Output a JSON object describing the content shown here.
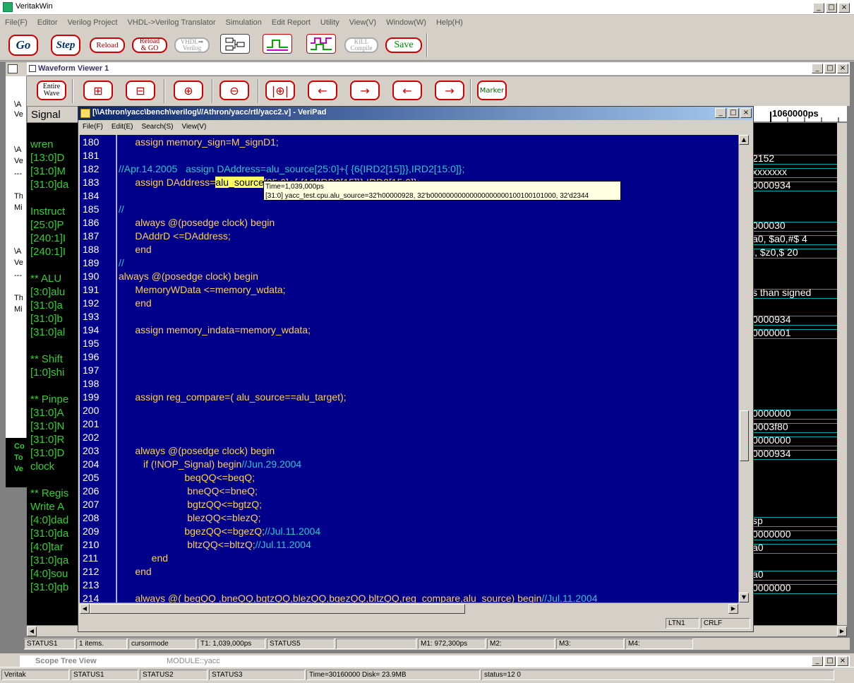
{
  "app": {
    "title": "VeritakWin",
    "menu": [
      "File(F)",
      "Editor",
      "Verilog Project",
      "VHDL->Verilog Translator",
      "Simulation",
      "Edit Report",
      "Utility",
      "View(V)",
      "Window(W)",
      "Help(H)"
    ]
  },
  "toolbar": {
    "go": "Go",
    "step": "Step",
    "reload": "Reload",
    "reload_go_1": "Reload",
    "reload_go_2": "& GO",
    "vhdl_1": "VHDL➡",
    "vhdl_2": "Verilog",
    "kill_1": "KILL",
    "kill_2": "Compile",
    "save": "Save"
  },
  "waveform_viewer": {
    "title": "Waveform Viewer 1",
    "entire_wave_1": "Entire",
    "entire_wave_2": "Wave",
    "marker": "Marker",
    "signal_header": "Signal",
    "time_header": "1060000ps",
    "signals": [
      "wren",
      "[13:0]D",
      "[31:0]M",
      "[31:0]da",
      "",
      "Instruct",
      "[25:0]P",
      "[240:1]I",
      "[240:1]I",
      "",
      "** ALU",
      "[3:0]alu",
      "[31:0]a",
      "[31:0]b",
      "[31:0]al",
      "",
      "** Shift",
      "[1:0]shi",
      "",
      "** Pinpe",
      "[31:0]A",
      "[31:0]N",
      "[31:0]R",
      "[31:0]D",
      "clock",
      "",
      "** Regis",
      " Write A",
      "[4:0]dad",
      "[31:0]da",
      "[4:0]tar",
      "[31:0]qa",
      "[4:0]sou",
      "[31:0]qb"
    ],
    "wave_values": [
      {
        "row": 1,
        "text": "2152"
      },
      {
        "row": 2,
        "text": "xxxxxxx"
      },
      {
        "row": 3,
        "text": "0000934"
      },
      {
        "row": 6,
        "text": "000030"
      },
      {
        "row": 7,
        "text": "a0, $a0,#$  4"
      },
      {
        "row": 8,
        "text": "l, $z0,$   20"
      },
      {
        "row": 11,
        "text": "s than signed"
      },
      {
        "row": 13,
        "text": "0000934"
      },
      {
        "row": 14,
        "text": "0000001"
      },
      {
        "row": 20,
        "text": "0000000"
      },
      {
        "row": 21,
        "text": "0003f80"
      },
      {
        "row": 22,
        "text": "0000000"
      },
      {
        "row": 23,
        "text": "0000934"
      },
      {
        "row": 28,
        "text": "sp"
      },
      {
        "row": 29,
        "text": "0000000"
      },
      {
        "row": 30,
        "text": "a0"
      },
      {
        "row": 32,
        "text": "a0"
      },
      {
        "row": 33,
        "text": "0000000"
      }
    ],
    "status": [
      {
        "text": "STATUS1"
      },
      {
        "text": "1 items."
      },
      {
        "text": "cursormode"
      },
      {
        "text": "T1: 1,039,000ps"
      },
      {
        "text": "STATUS5"
      },
      {
        "text": ""
      },
      {
        "text": "M1: 972,300ps"
      },
      {
        "text": "M2:"
      },
      {
        "text": "M3:"
      },
      {
        "text": "M4:"
      }
    ]
  },
  "left_strip": [
    "\\A",
    "Ve",
    "\\A",
    "Ve",
    "---",
    "Th",
    "Mi",
    "\\A",
    "Ve",
    "---",
    "Th",
    "Mi",
    "Co",
    "To",
    "Ve"
  ],
  "veripad": {
    "title": "[\\\\Athron\\yacc\\bench\\verilog\\//Athron/yacc/rtl/yacc2.v] - VeriPad",
    "menu": [
      "File(F)",
      "Edit(E)",
      "Search(S)",
      "View(V)"
    ],
    "status_ln": "LTN1",
    "status_crlf": "CRLF",
    "lines": [
      {
        "n": "180",
        "segs": [
          {
            "t": "      assign memory_sign=M_signD1;",
            "k": "y"
          }
        ]
      },
      {
        "n": "181",
        "segs": []
      },
      {
        "n": "182",
        "segs": [
          {
            "t": "//Apr.14.2005   assign DAddress=alu_source[25:0]+{ {6{IRD2[15]}},IRD2[15:0]};",
            "k": "c"
          }
        ]
      },
      {
        "n": "183",
        "segs": [
          {
            "t": "      assign DAddress=",
            "k": "y"
          },
          {
            "t": "alu_source",
            "k": "hl"
          },
          {
            "t": "[25:0]+{ {16{IRD2[15]}},IRD2[15:0]};",
            "k": "y"
          }
        ]
      },
      {
        "n": "184",
        "segs": []
      },
      {
        "n": "185",
        "segs": [
          {
            "t": "//",
            "k": "c"
          }
        ]
      },
      {
        "n": "186",
        "segs": [
          {
            "t": "      always @(posedge clock) begin",
            "k": "y"
          }
        ]
      },
      {
        "n": "187",
        "segs": [
          {
            "t": "      DAddrD <=DAddress;",
            "k": "y"
          }
        ]
      },
      {
        "n": "188",
        "segs": [
          {
            "t": "      end",
            "k": "y"
          }
        ]
      },
      {
        "n": "189",
        "segs": [
          {
            "t": "//",
            "k": "c"
          }
        ]
      },
      {
        "n": "190",
        "segs": [
          {
            "t": "always @(posedge clock) begin",
            "k": "y"
          }
        ]
      },
      {
        "n": "191",
        "segs": [
          {
            "t": "      MemoryWData <=memory_wdata;",
            "k": "y"
          }
        ]
      },
      {
        "n": "192",
        "segs": [
          {
            "t": "      end",
            "k": "y"
          }
        ]
      },
      {
        "n": "193",
        "segs": []
      },
      {
        "n": "194",
        "segs": [
          {
            "t": "      assign memory_indata=memory_wdata;",
            "k": "y"
          }
        ]
      },
      {
        "n": "195",
        "segs": []
      },
      {
        "n": "196",
        "segs": []
      },
      {
        "n": "197",
        "segs": []
      },
      {
        "n": "198",
        "segs": []
      },
      {
        "n": "199",
        "segs": [
          {
            "t": "      assign reg_compare=( alu_source==alu_target);",
            "k": "y"
          }
        ]
      },
      {
        "n": "200",
        "segs": []
      },
      {
        "n": "201",
        "segs": []
      },
      {
        "n": "202",
        "segs": []
      },
      {
        "n": "203",
        "segs": [
          {
            "t": "      always @(posedge clock) begin",
            "k": "y"
          }
        ]
      },
      {
        "n": "204",
        "segs": [
          {
            "t": "         if (!NOP_Signal) begin",
            "k": "y"
          },
          {
            "t": "//Jun.29.2004",
            "k": "c"
          }
        ]
      },
      {
        "n": "205",
        "segs": [
          {
            "t": "                        beqQQ<=beqQ;",
            "k": "y"
          }
        ]
      },
      {
        "n": "206",
        "segs": [
          {
            "t": "                         bneQQ<=bneQ;",
            "k": "y"
          }
        ]
      },
      {
        "n": "207",
        "segs": [
          {
            "t": "                         bgtzQQ<=bgtzQ;",
            "k": "y"
          }
        ]
      },
      {
        "n": "208",
        "segs": [
          {
            "t": "                         blezQQ<=blezQ;",
            "k": "y"
          }
        ]
      },
      {
        "n": "209",
        "segs": [
          {
            "t": "                        bgezQQ<=bgezQ;",
            "k": "y"
          },
          {
            "t": "//Jul.11.2004",
            "k": "c"
          }
        ]
      },
      {
        "n": "210",
        "segs": [
          {
            "t": "                         bltzQQ<=bltzQ;",
            "k": "y"
          },
          {
            "t": "//Jul.11.2004",
            "k": "c"
          }
        ]
      },
      {
        "n": "211",
        "segs": [
          {
            "t": "            end",
            "k": "y"
          }
        ]
      },
      {
        "n": "212",
        "segs": [
          {
            "t": "      end",
            "k": "y"
          }
        ]
      },
      {
        "n": "213",
        "segs": []
      },
      {
        "n": "214",
        "segs": [
          {
            "t": "      always @( beqQQ ,bneQQ,bgtzQQ,blezQQ,bgezQQ,bltzQQ,reg_compare,alu_source) begin",
            "k": "y"
          },
          {
            "t": "//Jul.11.2004",
            "k": "c"
          }
        ]
      }
    ],
    "tooltip_line1": "Time=1,039,000ps",
    "tooltip_line2": "[31:0] yacc_test.cpu.alu_source=32'h00000928, 32'b00000000000000000000100100101000, 32'd2344"
  },
  "scope_tree": {
    "title": "Scope Tree View",
    "module": "MODULE::yacc"
  },
  "main_status": [
    {
      "text": "Veritak"
    },
    {
      "text": "STATUS1"
    },
    {
      "text": "STATUS2"
    },
    {
      "text": "STATUS3"
    },
    {
      "text": "Time=30160000 Disk= 23.9MB"
    },
    {
      "text": "status=12 0"
    }
  ],
  "colors": {
    "editor_bg": "#00008b",
    "keyword": "#ffd24a",
    "comment": "#28c8c8",
    "signal_text": "#30d030"
  }
}
